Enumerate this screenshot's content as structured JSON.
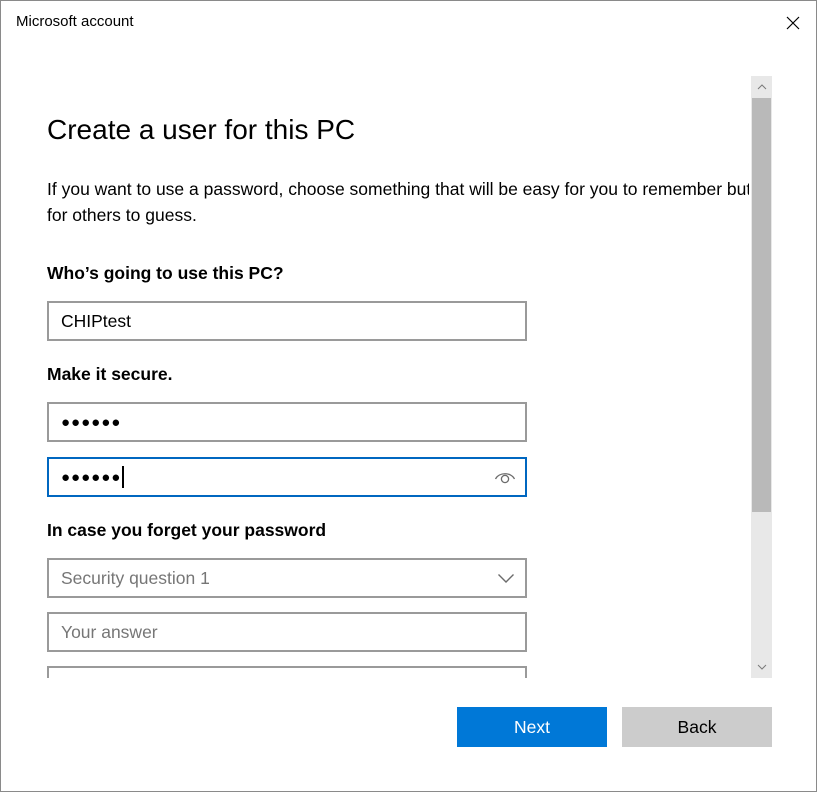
{
  "window": {
    "title": "Microsoft account"
  },
  "page": {
    "heading": "Create a user for this PC",
    "description": "If you want to use a password, choose something that will be easy for you to remember but hard for others to guess."
  },
  "user_section": {
    "label": "Who’s going to use this PC?",
    "username_value": "CHIPtest"
  },
  "secure_section": {
    "label": "Make it secure.",
    "password_value": "●●●●●●",
    "confirm_value": "●●●●●●"
  },
  "recovery_section": {
    "label": "In case you forget your password",
    "question_placeholder": "Security question 1",
    "answer_placeholder": "Your answer"
  },
  "buttons": {
    "next": "Next",
    "back": "Back"
  },
  "colors": {
    "accent": "#0078d7",
    "focus_border": "#0067c0",
    "secondary_button": "#cccccc"
  },
  "icons": [
    "close-icon",
    "eye-icon",
    "chevron-down-icon",
    "scroll-up-icon",
    "scroll-down-icon"
  ]
}
